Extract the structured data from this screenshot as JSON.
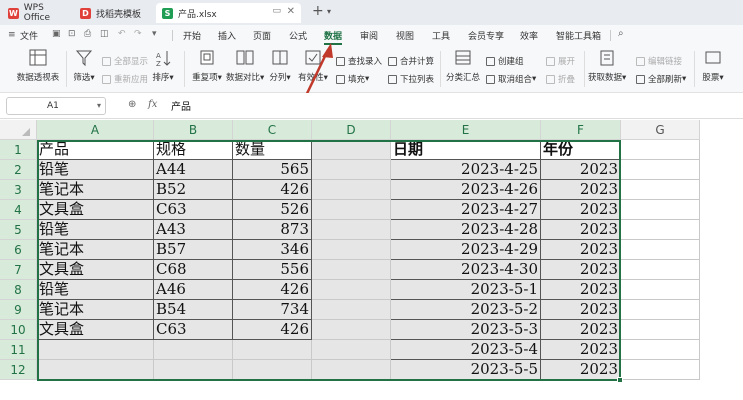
{
  "tabs": [
    {
      "label": "WPS Office",
      "icon": "wps-logo-icon"
    },
    {
      "label": "找稻壳模板",
      "icon": "docer-icon"
    },
    {
      "label": "产品.xlsx",
      "icon": "spreadsheet-icon"
    }
  ],
  "ribbon_tabs": [
    "文件",
    "开始",
    "插入",
    "页面",
    "公式",
    "数据",
    "审阅",
    "视图",
    "工具",
    "会员专享",
    "效率",
    "智能工具箱"
  ],
  "active_tab": "数据",
  "ribbon": {
    "pivot": "数据透视表",
    "filter": "筛选",
    "show_all": "全部显示",
    "reapply": "重新应用",
    "sort": "排序",
    "duplicates": "重复项",
    "compare": "数据对比",
    "split": "分列",
    "validity": "有效性",
    "find_entry": "查找录入",
    "fill": "填充",
    "merge_calc": "合并计算",
    "dropdown": "下拉列表",
    "subtotal": "分类汇总",
    "create_group": "创建组",
    "ungroup": "取消组合",
    "expand": "展开",
    "collapse": "折叠",
    "get_data": "获取数据",
    "refresh_all": "全部刷新",
    "edit_links": "编辑链接",
    "stocks": "股票"
  },
  "formula_bar": {
    "cell_ref": "A1",
    "fx": "fx",
    "content": "产品"
  },
  "columns": [
    "A",
    "B",
    "C",
    "D",
    "E",
    "F",
    "G"
  ],
  "rows": [
    "1",
    "2",
    "3",
    "4",
    "5",
    "6",
    "7",
    "8",
    "9",
    "10",
    "11",
    "12"
  ],
  "table1": {
    "headers": [
      "产品",
      "规格",
      "数量"
    ],
    "rows": [
      [
        "铅笔",
        "A44",
        "565"
      ],
      [
        "笔记本",
        "B52",
        "426"
      ],
      [
        "文具盒",
        "C63",
        "526"
      ],
      [
        "铅笔",
        "A43",
        "873"
      ],
      [
        "笔记本",
        "B57",
        "346"
      ],
      [
        "文具盒",
        "C68",
        "556"
      ],
      [
        "铅笔",
        "A46",
        "426"
      ],
      [
        "笔记本",
        "B54",
        "734"
      ],
      [
        "文具盒",
        "C63",
        "426"
      ]
    ]
  },
  "table2": {
    "headers": [
      "日期",
      "年份"
    ],
    "rows": [
      [
        "2023-4-25",
        "2023"
      ],
      [
        "2023-4-26",
        "2023"
      ],
      [
        "2023-4-27",
        "2023"
      ],
      [
        "2023-4-28",
        "2023"
      ],
      [
        "2023-4-29",
        "2023"
      ],
      [
        "2023-4-30",
        "2023"
      ],
      [
        "2023-5-1",
        "2023"
      ],
      [
        "2023-5-2",
        "2023"
      ],
      [
        "2023-5-3",
        "2023"
      ],
      [
        "2023-5-4",
        "2023"
      ],
      [
        "2023-5-5",
        "2023"
      ]
    ]
  },
  "colors": {
    "accent": "#217346",
    "arrow": "#c0392b",
    "selection_fill": "#e6e6e6"
  }
}
